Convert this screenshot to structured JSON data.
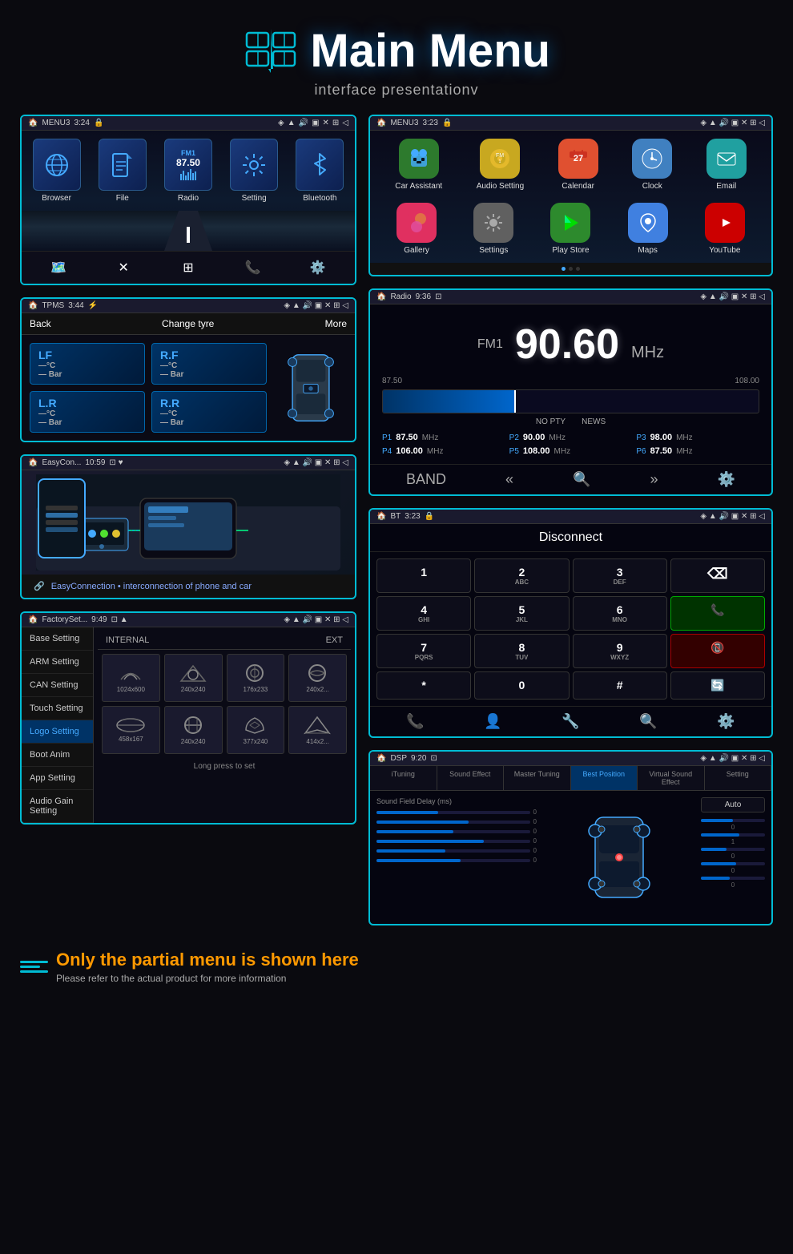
{
  "header": {
    "title": "Main Menu",
    "subtitle": "interface presentationv",
    "icon_symbol": "📚"
  },
  "panel_menu1": {
    "title": "MENU3",
    "time": "3:24",
    "apps": [
      {
        "name": "Browser",
        "icon": "🌐",
        "color": "#1a3a6c"
      },
      {
        "name": "File",
        "icon": "📁",
        "color": "#1a3a6c"
      },
      {
        "name": "Radio",
        "icon": "📻",
        "color": "#1a3a6c",
        "freq": "FM1",
        "num": "87.50"
      },
      {
        "name": "Setting",
        "icon": "⚙️",
        "color": "#1a3a6c"
      },
      {
        "name": "Bluetooth",
        "icon": "🔵",
        "color": "#1a3a6c"
      }
    ],
    "nav": [
      "🗺️",
      "❌",
      "⋮⋮",
      "📞",
      "⚙️"
    ]
  },
  "panel_tpms": {
    "title": "TPMS",
    "time": "3:44",
    "back": "Back",
    "change": "Change tyre",
    "more": "More",
    "tyres": [
      {
        "id": "LF",
        "temp": "—°C",
        "pressure": "— Bar"
      },
      {
        "id": "R.F",
        "temp": "—°C",
        "pressure": "— Bar"
      },
      {
        "id": "L.R",
        "temp": "—°C",
        "pressure": "— Bar"
      },
      {
        "id": "R.R",
        "temp": "—°C",
        "pressure": "— Bar"
      }
    ]
  },
  "panel_easy": {
    "title": "EasyCon...",
    "time": "10:59",
    "footer": "EasyConnection • interconnection of phone and car"
  },
  "panel_factory": {
    "title": "FactorySet...",
    "time": "9:49",
    "sidebar": [
      "Base Setting",
      "ARM Setting",
      "CAN Setting",
      "Touch Setting",
      "Logo Setting",
      "Boot Anim",
      "App Setting",
      "Audio Gain Setting"
    ],
    "active_item": "Logo Setting",
    "internal_label": "INTERNAL",
    "ext_label": "EXT",
    "logos": [
      {
        "size": "1024x600"
      },
      {
        "size": "240x240"
      },
      {
        "size": "176x233"
      },
      {
        "size": "240x2..."
      },
      {
        "size": "458x167"
      },
      {
        "size": "240x240"
      },
      {
        "size": "377x240"
      },
      {
        "size": "414x2..."
      }
    ],
    "footer": "Long press to set"
  },
  "panel_menu2": {
    "title": "MENU3",
    "time": "3:23",
    "row1": [
      {
        "name": "Car Assistant",
        "icon": "🤖",
        "bg": "#2d6a2d"
      },
      {
        "name": "Audio Setting",
        "icon": "🔊",
        "bg": "#c8a820"
      },
      {
        "name": "Calendar",
        "icon": "📅",
        "bg": "#e05030"
      },
      {
        "name": "Clock",
        "icon": "🕐",
        "bg": "#4080c0"
      },
      {
        "name": "Email",
        "icon": "📧",
        "bg": "#20a0a0"
      }
    ],
    "row2": [
      {
        "name": "Gallery",
        "icon": "🖼️",
        "bg": "#e03060"
      },
      {
        "name": "Settings",
        "icon": "⚙️",
        "bg": "#606060"
      },
      {
        "name": "Play Store",
        "icon": "▶️",
        "bg": "#2d8a2d"
      },
      {
        "name": "Maps",
        "icon": "🗺️",
        "bg": "#4080e0"
      },
      {
        "name": "YouTube",
        "icon": "▶️",
        "bg": "#cc0000"
      }
    ]
  },
  "panel_radio": {
    "title": "Radio",
    "time": "9:36",
    "band": "FM1",
    "frequency": "90.60",
    "unit": "MHz",
    "low_freq": "87.50",
    "high_freq": "108.00",
    "no_pty": "NO PTY",
    "news": "NEWS",
    "presets": [
      {
        "num": "P1",
        "freq": "87.50",
        "unit": "MHz"
      },
      {
        "num": "P2",
        "freq": "90.00",
        "unit": "MHz"
      },
      {
        "num": "P3",
        "freq": "98.00",
        "unit": "MHz"
      },
      {
        "num": "P4",
        "freq": "106.00",
        "unit": "MHz"
      },
      {
        "num": "P5",
        "freq": "108.00",
        "unit": "MHz"
      },
      {
        "num": "P6",
        "freq": "87.50",
        "unit": "MHz"
      }
    ],
    "controls": [
      "BAND",
      "«",
      "🔍",
      "»",
      "⚙️"
    ]
  },
  "panel_bt": {
    "title": "BT",
    "time": "3:23",
    "disconnect": "Disconnect",
    "keypad": [
      {
        "main": "1",
        "sub": ""
      },
      {
        "main": "2",
        "sub": "ABC"
      },
      {
        "main": "3",
        "sub": "DEF"
      },
      {
        "main": "⌫",
        "sub": ""
      },
      {
        "main": "4",
        "sub": "GHI"
      },
      {
        "main": "5",
        "sub": "JKL"
      },
      {
        "main": "6",
        "sub": "MNO"
      },
      {
        "main": "📞",
        "sub": "",
        "type": "green"
      },
      {
        "main": "7",
        "sub": "PQRS"
      },
      {
        "main": "8",
        "sub": "TUV"
      },
      {
        "main": "9",
        "sub": "WXYZ"
      },
      {
        "main": "📵",
        "sub": "",
        "type": "red"
      },
      {
        "main": "*",
        "sub": ""
      },
      {
        "main": "0",
        "sub": ""
      },
      {
        "main": "#",
        "sub": ""
      },
      {
        "main": "🔄",
        "sub": ""
      }
    ],
    "bottom_icons": [
      "📞",
      "📷",
      "🔧",
      "🔍",
      "⚙️"
    ]
  },
  "panel_dsp": {
    "title": "DSP",
    "time": "9:20",
    "tabs": [
      "iTuning",
      "Sound Effect",
      "Master Tuning",
      "Best Position",
      "Virtual Sound Effect",
      "Setting"
    ],
    "active_tab": "Best Position",
    "sound_field_delay": "Sound Field Delay (ms)",
    "auto_btn": "Auto",
    "sliders": [
      {
        "label": "",
        "value": 40
      },
      {
        "label": "",
        "value": 60
      },
      {
        "label": "",
        "value": 50
      },
      {
        "label": "",
        "value": 70
      },
      {
        "label": "",
        "value": 45
      },
      {
        "label": "",
        "value": 55
      }
    ],
    "right_values": [
      {
        "val": "0",
        "fill": 50
      },
      {
        "val": "1",
        "fill": 60
      },
      {
        "val": "0",
        "fill": 40
      },
      {
        "val": "0",
        "fill": 55
      },
      {
        "val": "0",
        "fill": 45
      }
    ]
  },
  "footer": {
    "main_text": "Only the partial menu is shown here",
    "sub_text": "Please refer to the actual product for more information"
  }
}
